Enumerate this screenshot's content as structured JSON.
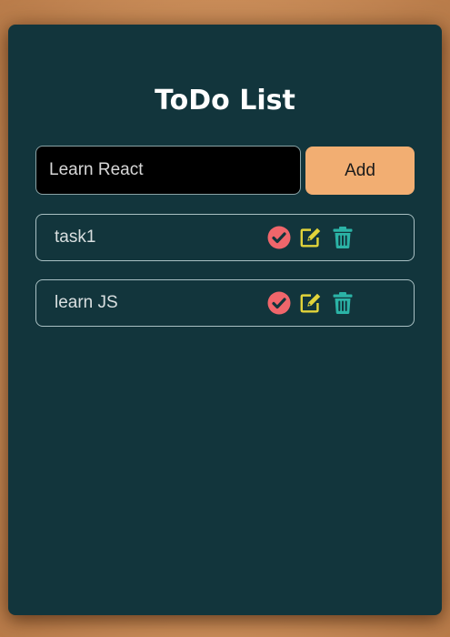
{
  "app": {
    "title": "ToDo List"
  },
  "input": {
    "value": "Learn React",
    "add_label": "Add"
  },
  "todos": [
    {
      "text": "task1"
    },
    {
      "text": "learn JS"
    }
  ],
  "icons": {
    "complete": "check-circle-icon",
    "edit": "edit-icon",
    "delete": "trash-icon"
  },
  "colors": {
    "card_bg": "#12353c",
    "add_button": "#f2ae72",
    "complete_icon": "#f0666b",
    "edit_icon": "#e2d43a",
    "delete_icon": "#2bb3a6"
  }
}
